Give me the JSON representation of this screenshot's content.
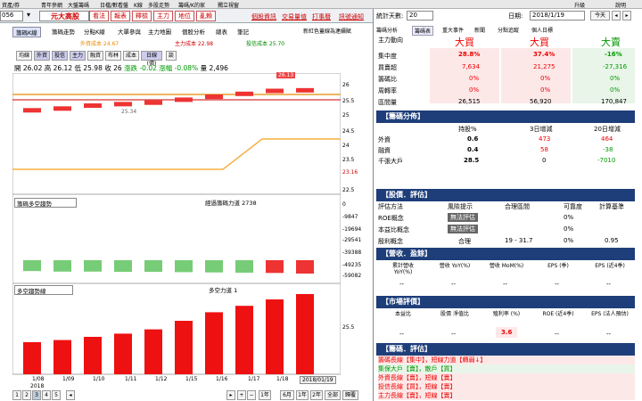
{
  "topbar": {
    "items": [
      "資產/券",
      "青年參網",
      "大盤籌碼",
      "日檔/數看盤",
      "K線",
      "多股走勢",
      "籌碼/K的家",
      "獨立視窗"
    ],
    "right": [
      "升級",
      "說明"
    ]
  },
  "toolbar": {
    "code": "056",
    "stock": "元大高股",
    "buttons": [
      "看法",
      "報表",
      "釋檢",
      "主力",
      "地位",
      "亂賴"
    ],
    "links": [
      "個股資訊",
      "交易量值",
      "打事曆",
      "訊號通知"
    ]
  },
  "chart_tabs": [
    "籌碼K線",
    "籌碼走勢",
    "分點K線",
    "大單參與",
    "主力地圖",
    "個股分析",
    "總表",
    "筆記"
  ],
  "legend": {
    "a": "外資成本 24.67",
    "b": "主力成本 22.98",
    "c": "投信成本 25.70",
    "note": "新紅色蓋線為連續賦"
  },
  "ohlc": {
    "open": "開 26.02",
    "high": "高 26.12",
    "low": "低 25.98",
    "close": "收 26",
    "chg": "漲跌 -0.02",
    "pct": "漲幅 -0.08%",
    "vol": "量 2,496"
  },
  "indicator_btns": [
    "均線",
    "外資",
    "投信",
    "主力",
    "融資",
    "布林",
    "成本",
    "日線(價)",
    "談"
  ],
  "price_labels": {
    "p1": "26.13",
    "p2": "25.34"
  },
  "chart_data": [
    {
      "type": "bar",
      "title": "",
      "categories": [
        "1/08",
        "1/09",
        "1/10",
        "1/11",
        "1/12",
        "1/15",
        "1/16",
        "1/17",
        "1/18",
        "1/19"
      ],
      "series": [
        {
          "name": "",
          "values": [
            25.34,
            25.4,
            25.5,
            25.55,
            25.6,
            25.7,
            25.8,
            25.9,
            26.0,
            26.02
          ]
        }
      ],
      "ylim": [
        22.5,
        26.5
      ]
    },
    {
      "type": "bar",
      "title": "經過籌碼力道 2738",
      "categories": [
        "1/08",
        "1/09",
        "1/10",
        "1/11",
        "1/12",
        "1/15",
        "1/16",
        "1/17",
        "1/18",
        "1/19"
      ],
      "series": [
        {
          "name": "",
          "values": [
            -40000,
            -42000,
            -42000,
            -43000,
            -43000,
            -44000,
            -45000,
            -46000,
            -47000,
            -49235
          ]
        }
      ]
    },
    {
      "type": "bar",
      "title": "多空力道 1",
      "categories": [
        "1/08",
        "1/09",
        "1/10",
        "1/11",
        "1/12",
        "1/15",
        "1/16",
        "1/17",
        "1/18",
        "1/19"
      ],
      "series": [
        {
          "name": "",
          "values": [
            30,
            32,
            35,
            38,
            42,
            50,
            58,
            64,
            70,
            75
          ]
        }
      ]
    }
  ],
  "yaxis": [
    "26",
    "25.5",
    "25",
    "24.5",
    "24",
    "23.5",
    "23.16",
    "22.5",
    "0",
    "-9847",
    "-19694",
    "-29541",
    "-39388",
    "-49235",
    "-59082",
    "25.5"
  ],
  "lower": {
    "sel1": "籌碼多空趨勢",
    "sel2": "多空趨勢線"
  },
  "xaxis": [
    "1/08",
    "1/09",
    "1/10",
    "1/11",
    "1/12",
    "1/15",
    "1/16",
    "1/17",
    "1/18",
    "2018/01/19"
  ],
  "xyear": "2018",
  "bottom_buttons": [
    "1",
    "2",
    "3",
    "4",
    "5",
    "1年",
    "6月",
    "1年",
    "2年",
    "全部",
    "歸覆"
  ],
  "right": {
    "days_label": "統計天數:",
    "days": "20",
    "date_label": "日期:",
    "date": "2018/1/19",
    "today": "今天",
    "tabs": [
      "籌碼分析",
      "籌碼表",
      "重大事件",
      "新聞",
      "分點追蹤",
      "個人日標"
    ],
    "head": [
      "主力動向",
      "大買",
      "大買",
      "大賣"
    ],
    "rows": [
      [
        "集中度",
        "28.8%",
        "37.4%",
        "-16%"
      ],
      [
        "買賣超",
        "7,634",
        "21,275",
        "-27,316"
      ],
      [
        "籌碼比",
        "0%",
        "0%",
        "0%"
      ],
      [
        "周轉率",
        "0%",
        "0%",
        "0%"
      ],
      [
        "區間量",
        "26,515",
        "56,920",
        "170,847"
      ]
    ],
    "dist_title": "【籌碼分佈】",
    "dist_head": [
      "持股%",
      "3日增減",
      "20日增減"
    ],
    "dist": [
      [
        "外資",
        "0.6",
        "473",
        "464"
      ],
      [
        "融資",
        "0.4",
        "58",
        "-38"
      ],
      [
        "千張大戶",
        "28.5",
        "0",
        "-7010"
      ]
    ],
    "eval_title": "【股價．評估】",
    "eval_head": [
      "評估方法",
      "風險提示",
      "合理區間",
      "可靠度",
      "計算基準"
    ],
    "eval": [
      [
        "ROE概念",
        "無法評估",
        "",
        "0%",
        ""
      ],
      [
        "本益比概念",
        "無法評估",
        "",
        "0%",
        ""
      ],
      [
        "殷利概念",
        "合理",
        "19 - 31.7",
        "0%",
        "0.95"
      ]
    ],
    "rev_title": "【營收．盈餘】",
    "rev_head": [
      "累計營收 YoY(%)",
      "營收 YoY(%)",
      "營收 MoM(%)",
      "EPS (季)",
      "EPS (近4季)"
    ],
    "rev_vals": [
      "--",
      "--",
      "--",
      "--",
      "--"
    ],
    "mkt_title": "【市場評價】",
    "mkt_head": [
      "本益比",
      "股價 淨值比",
      "殖利率 (%)",
      "ROE (近4季)",
      "EPS (法人預估)"
    ],
    "mkt_vals": [
      "--",
      "--",
      "3.6",
      "--",
      "--"
    ],
    "sig_title": "【籌碼．評估】",
    "signals": [
      "籌碼長線【集中】，短線力道【轉弱↓】",
      "集保大戶【賣】，散戶【買】",
      "外資長線【賣】，短線【賣】",
      "投信長線【買】，短線【賣】",
      "主力長線【賣】，短線【賣】"
    ]
  }
}
